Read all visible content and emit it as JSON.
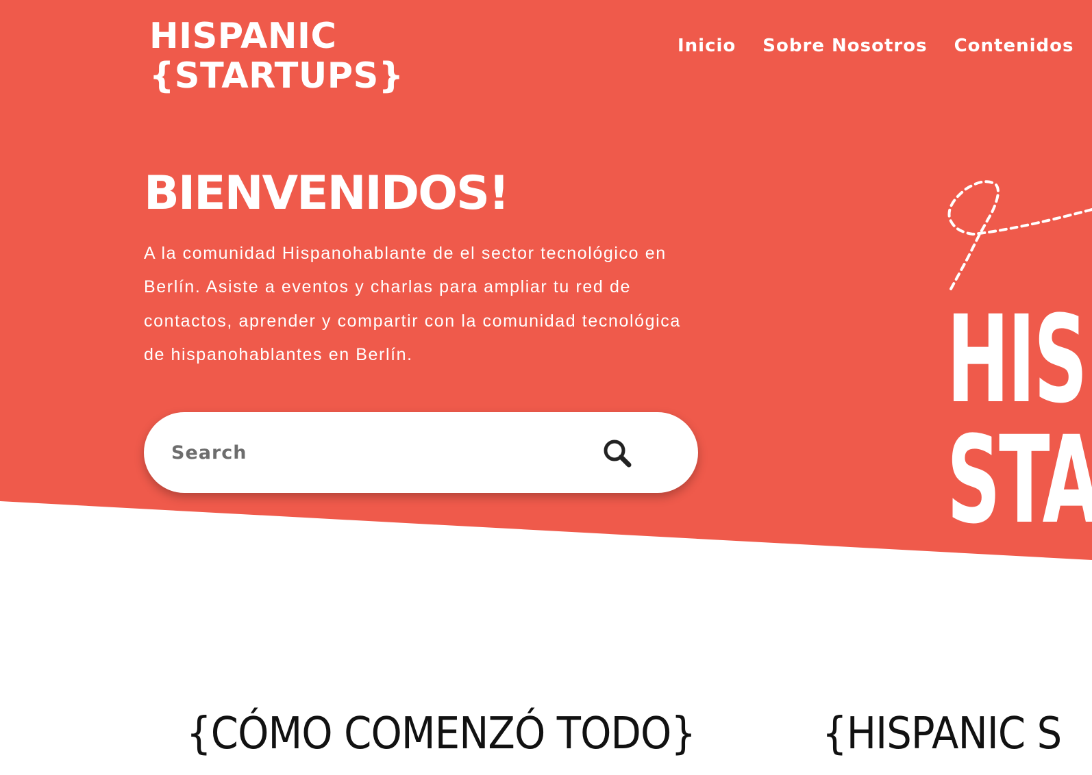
{
  "colors": {
    "hero_background": "#EF5A4B",
    "text_on_hero": "#FFFFFF",
    "page_background": "#FFFFFF",
    "heading_text": "#111111"
  },
  "brand": {
    "line1": "HISPANIC",
    "line2": "{STARTUPS}"
  },
  "nav": {
    "items": [
      {
        "label": "Inicio"
      },
      {
        "label": "Sobre Nosotros"
      },
      {
        "label": "Contenidos"
      }
    ]
  },
  "hero": {
    "title": "BIENVENIDOS!",
    "description": "A la comunidad Hispanohablante de el sector tecnológico en Berlín. Asiste a eventos y charlas para ampliar tu red de contactos, aprender y compartir con la comunidad tecnológica de hispanohablantes en Berlín."
  },
  "search": {
    "placeholder": "Search",
    "icon": "search-icon"
  },
  "hero_graphic": {
    "line1": "HIS",
    "line2": "STA"
  },
  "sections": {
    "headings": [
      {
        "label": "{CÓMO COMENZÓ TODO}"
      },
      {
        "label": "{HISPANIC S"
      }
    ]
  }
}
